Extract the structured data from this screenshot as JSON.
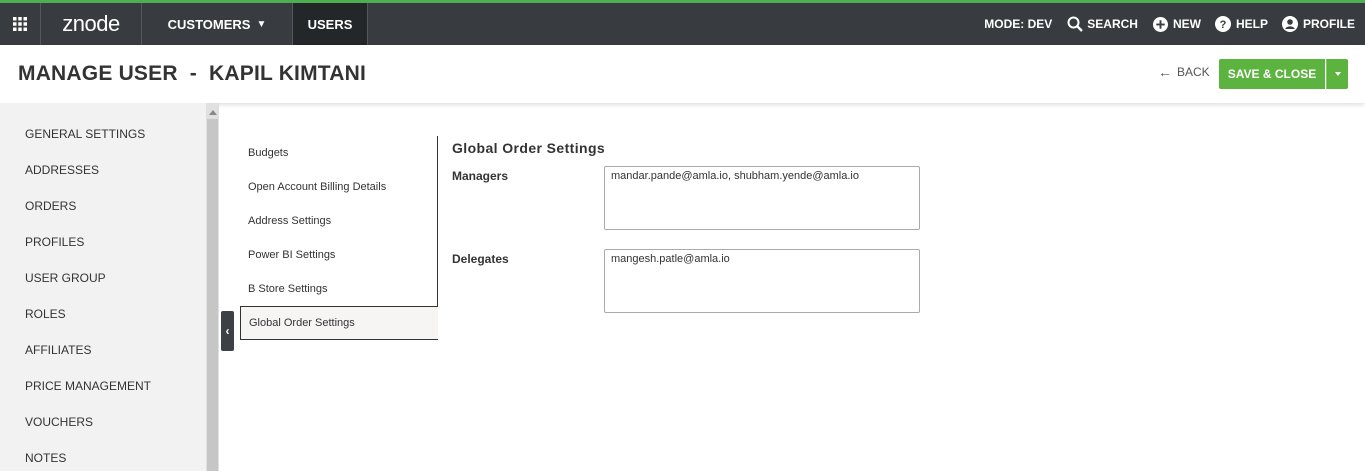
{
  "app": {
    "logo_text": "znode"
  },
  "topnav": {
    "customers_label": "CUSTOMERS",
    "users_label": "USERS",
    "mode_label": "MODE: DEV",
    "search_label": "SEARCH",
    "new_label": "NEW",
    "help_label": "HELP",
    "profile_label": "PROFILE"
  },
  "header": {
    "title": "MANAGE USER  -  KAPIL KIMTANI",
    "back_label": "BACK",
    "save_label": "SAVE & CLOSE"
  },
  "sidebar": {
    "items": [
      {
        "label": "GENERAL SETTINGS"
      },
      {
        "label": "ADDRESSES"
      },
      {
        "label": "ORDERS"
      },
      {
        "label": "PROFILES"
      },
      {
        "label": "USER GROUP"
      },
      {
        "label": "ROLES"
      },
      {
        "label": "AFFILIATES"
      },
      {
        "label": "PRICE MANAGEMENT"
      },
      {
        "label": "VOUCHERS"
      },
      {
        "label": "NOTES"
      }
    ]
  },
  "tabs": {
    "items": [
      {
        "label": "Budgets"
      },
      {
        "label": "Open Account Billing Details"
      },
      {
        "label": "Address Settings"
      },
      {
        "label": "Power BI Settings"
      },
      {
        "label": "B Store Settings"
      },
      {
        "label": "Global Order Settings"
      }
    ],
    "active": "Global Order Settings"
  },
  "content": {
    "title": "Global Order Settings",
    "managers_label": "Managers",
    "managers_value": "mandar.pande@amla.io, shubham.yende@amla.io",
    "delegates_label": "Delegates",
    "delegates_value": "mangesh.patle@amla.io"
  },
  "colors": {
    "topbar": "#383c40",
    "accent_green": "#5cb33f",
    "sidebar_bg": "#f2f2f2"
  }
}
